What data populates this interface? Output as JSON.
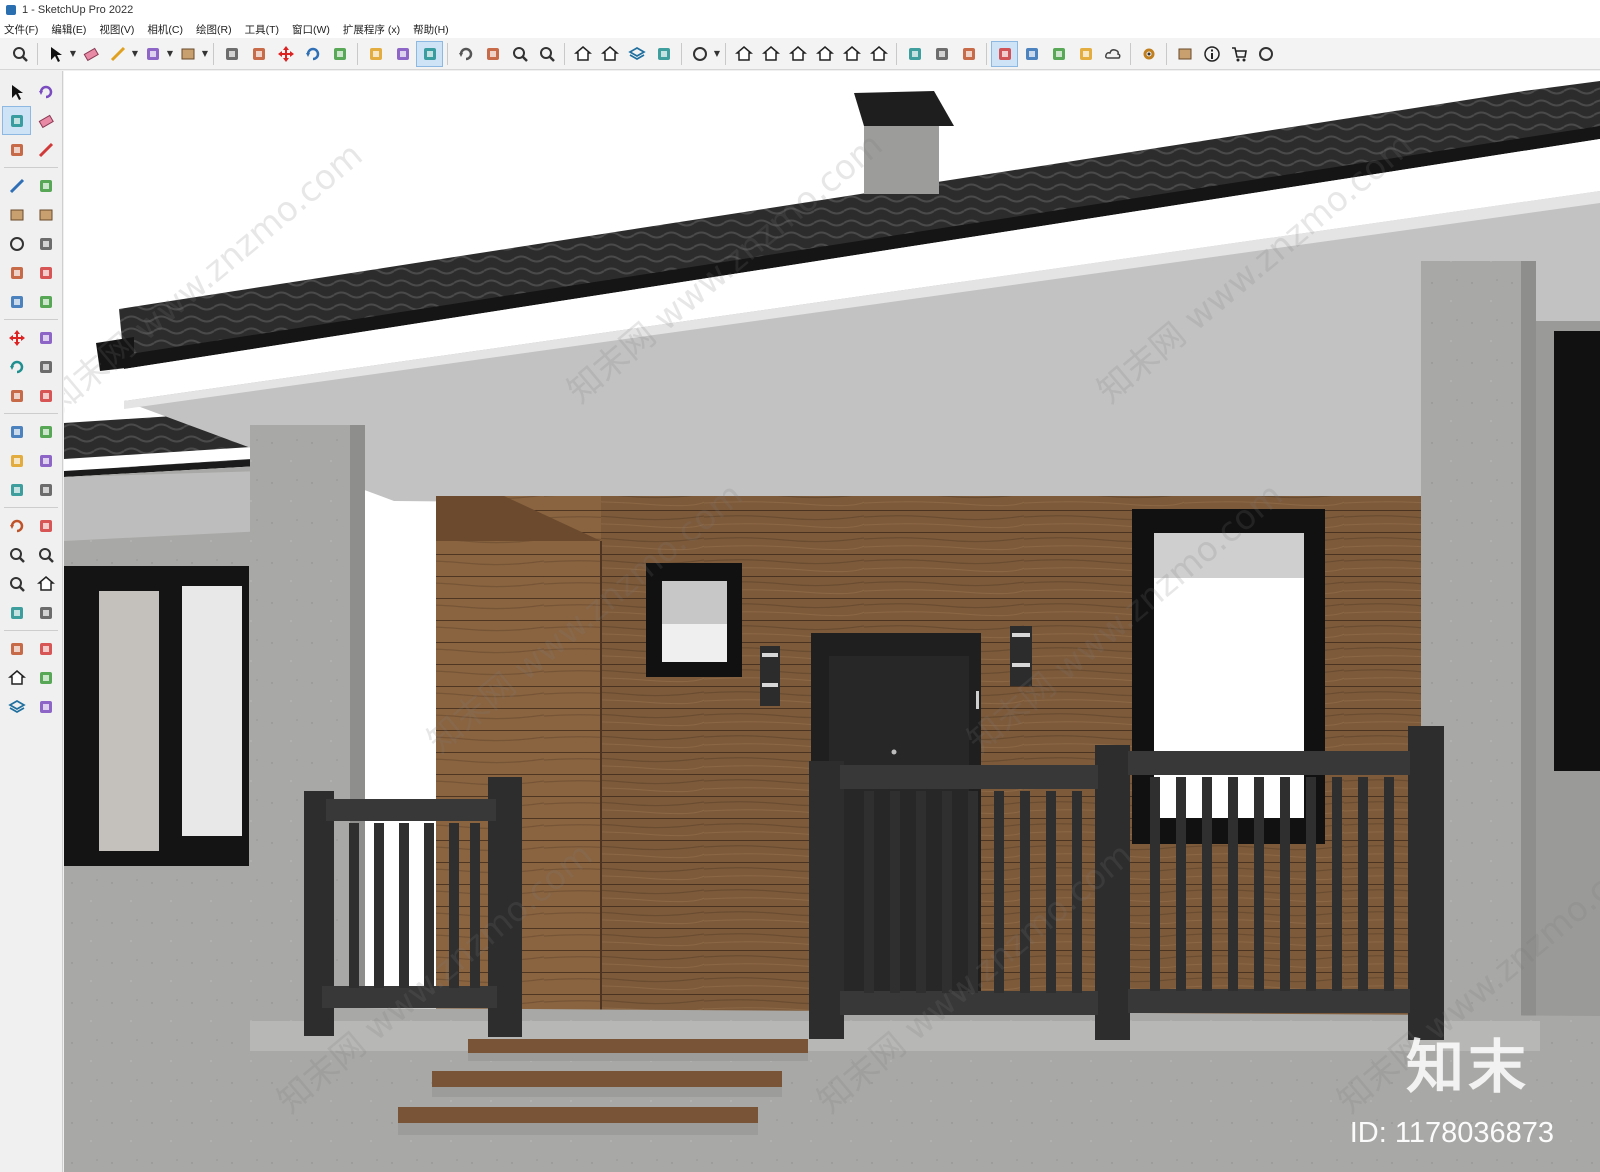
{
  "window": {
    "title": "1 - SketchUp Pro 2022"
  },
  "menu": {
    "items": [
      "文件(F)",
      "编辑(E)",
      "视图(V)",
      "相机(C)",
      "绘图(R)",
      "工具(T)",
      "窗口(W)",
      "扩展程序 (x)",
      "帮助(H)"
    ]
  },
  "toolbar": {
    "buttons": [
      "search-icon",
      "select-icon",
      "eraser-icon",
      "pencil-icon",
      "arc-icon",
      "rectangle-icon",
      "push-pull-icon",
      "follow-me-icon",
      "move-icon",
      "rotate-icon",
      "scale-icon",
      "tape-measure-icon",
      "text-label-icon",
      "paint-bucket-icon",
      "orbit-icon",
      "pan-icon",
      "zoom-icon",
      "zoom-extents-icon",
      "warehouse-icon",
      "extension-warehouse-icon",
      "layers-icon",
      "sandbox-icon",
      "account-icon",
      "iso-view-icon",
      "front-view-icon",
      "home-view-icon",
      "back-view-icon",
      "house-view-icon",
      "left-view-icon",
      "component-icon",
      "section-icon",
      "group-icon",
      "add-location-icon",
      "shadow-icon",
      "style-icon",
      "texture-icon",
      "cloud-icon",
      "settings-icon",
      "window-icon",
      "info-icon",
      "cart-icon",
      "profile-icon"
    ]
  },
  "lefttools": {
    "buttons": [
      "select-arrow-icon",
      "orbit-small-icon",
      "paint-icon",
      "eraser-icon",
      "component-icon",
      "pencil-icon",
      "line-icon",
      "freehand-icon",
      "rectangle-icon",
      "rotated-rect-icon",
      "circle-icon",
      "polygon-icon",
      "arc-icon",
      "pie-icon",
      "two-point-arc-icon",
      "three-point-arc-icon",
      "move-icon",
      "push-pull-icon",
      "rotate-icon",
      "follow-me-icon",
      "scale-icon",
      "offset-icon",
      "tape-icon",
      "dimension-icon",
      "protractor-icon",
      "text-icon",
      "axes-icon",
      "3d-text-icon",
      "orbit-icon",
      "pan-icon",
      "zoom-icon",
      "zoom-window-icon",
      "zoom-extents-icon",
      "previous-view-icon",
      "position-camera-icon",
      "look-around-icon",
      "walk-icon",
      "section-plane-icon",
      "warehouse-icon",
      "extension-icon",
      "layers-icon",
      "sandbox-icon"
    ]
  },
  "viewport": {
    "watermark_text": "知末网 www.znzmo.com",
    "brand_logo": "知末",
    "brand_id": "ID: 1178036873"
  }
}
